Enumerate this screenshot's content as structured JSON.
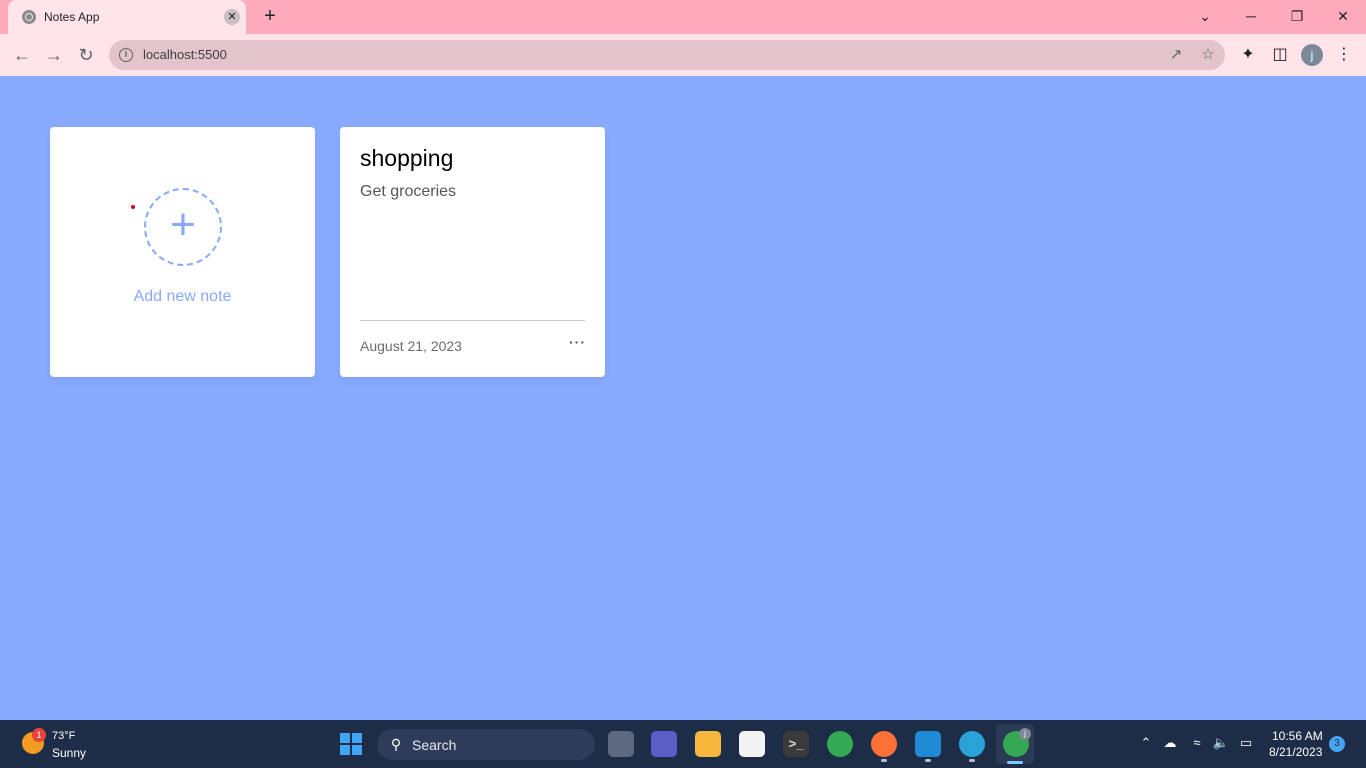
{
  "browser": {
    "tab_title": "Notes App",
    "tab_close_glyph": "✕",
    "new_tab_glyph": "+",
    "url": "localhost:5500",
    "minimize_glyph": "─",
    "maximize_glyph": "❐",
    "close_glyph": "✕",
    "tab_search_glyph": "⌄",
    "profile_initial": "j"
  },
  "notes_app": {
    "add_note_label": "Add new note",
    "add_plus_glyph": "+",
    "notes": [
      {
        "title": "shopping",
        "description": "Get groceries",
        "date": "August 21, 2023",
        "menu_glyph": "···"
      }
    ],
    "colors": {
      "background": "#88aafd",
      "card": "#ffffff",
      "accent": "#88aafd"
    }
  },
  "taskbar": {
    "weather_temp": "73°F",
    "weather_condition": "Sunny",
    "weather_badge": "1",
    "search_label": "Search",
    "clock_time": "10:56 AM",
    "clock_date": "8/21/2023",
    "notification_count": "3",
    "chrome_profile_badge": "j"
  }
}
